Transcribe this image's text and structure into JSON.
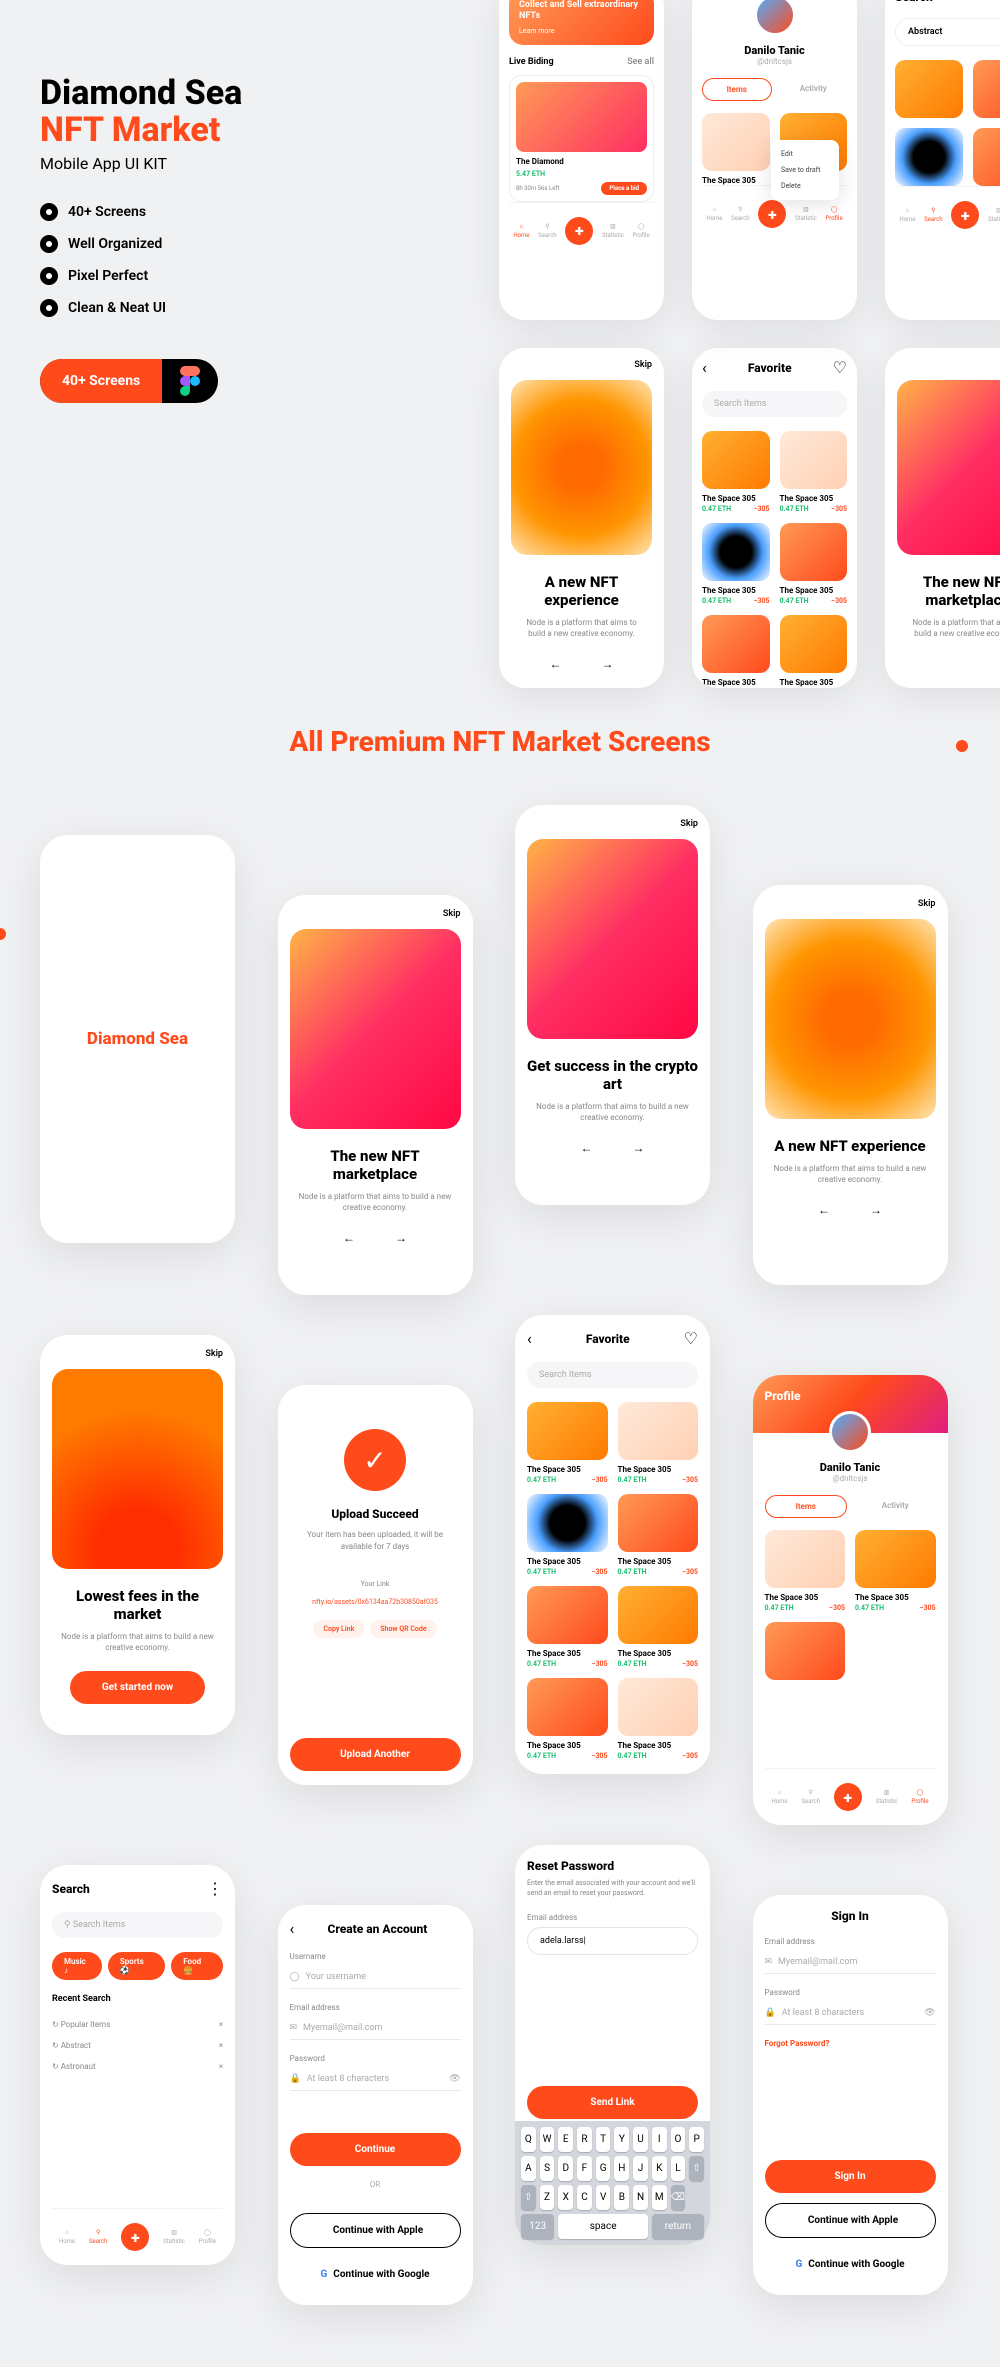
{
  "hero": {
    "title1": "Diamond Sea",
    "title2": "NFT Market",
    "subtitle": "Mobile App UI KIT",
    "features": [
      "40+ Screens",
      "Well Organized",
      "Pixel Perfect",
      "Clean & Neat UI"
    ],
    "cta": "40+ Screens"
  },
  "section_title": "All Premium NFT Market Screens",
  "common": {
    "skip": "Skip",
    "ob_desc": "Node is a platform that aims to build a new creative economy.",
    "nav": {
      "home": "Home",
      "search": "Search",
      "statistic": "Statistic",
      "profile": "Profile"
    },
    "item_name": "The Space 305",
    "price": "0.47 ETH",
    "change": "−305"
  },
  "top": {
    "promo": {
      "title": "Collect and Sell extraordinary NFTs",
      "learn": "Learn more"
    },
    "live": {
      "heading": "Live Biding",
      "see": "See all",
      "item": "The Diamond",
      "price": "5.47 ETH",
      "time": "8h 30m 56s Left",
      "btn": "Place a bid"
    },
    "profile": {
      "name": "Danilo Tanic",
      "handle": "@dnltcsjs",
      "tab_items": "Items",
      "tab_activity": "Activity"
    },
    "menu": {
      "edit": "Edit",
      "save": "Save to draft",
      "delete": "Delete"
    },
    "search": {
      "title": "Search",
      "term": "Abstract"
    },
    "ob1": {
      "title": "A new NFT experience"
    },
    "favorite": {
      "title": "Favorite",
      "search": "Search Items"
    },
    "ob2": {
      "title": "The new NFT marketplace"
    }
  },
  "row1": {
    "splash": "Diamond Sea",
    "ob_marketplace": "The new NFT marketplace",
    "ob_crypto": "Get success in the crypto art",
    "ob_experience": "A new NFT experience"
  },
  "row2": {
    "lowest": {
      "title": "Lowest fees in the market",
      "btn": "Get started now"
    },
    "upload": {
      "title": "Upload Succeed",
      "desc": "Your item has been uploaded, it will be available for 7 days",
      "link_label": "Your Link",
      "link": "nfty.io/assets/0x6134aa72b30850af035",
      "copy": "Copy Link",
      "share": "Show QR Code",
      "another": "Upload Another"
    },
    "favorite": {
      "title": "Favorite",
      "search": "Search Items"
    },
    "profile": {
      "title": "Profile",
      "name": "Danilo Tanic",
      "handle": "@dnltcsjs",
      "tab_items": "Items",
      "tab_activity": "Activity"
    }
  },
  "row3": {
    "search": {
      "title": "Search",
      "ph": "Search Items",
      "chips": [
        "Music",
        "Sports",
        "Food"
      ],
      "recent_title": "Recent Search",
      "recent": [
        "Popular Items",
        "Abstract",
        "Astronaut"
      ]
    },
    "create": {
      "title": "Create an Account",
      "user_lbl": "Username",
      "user_ph": "Your username",
      "email_lbl": "Email address",
      "email_ph": "Myemail@mail.com",
      "pass_lbl": "Password",
      "pass_ph": "At least 8 characters",
      "continue": "Continue",
      "or": "OR",
      "apple": "Continue with Apple",
      "google": "Continue with Google"
    },
    "reset": {
      "title": "Reset Password",
      "desc": "Enter the email associated with your account and we'll send an email to reset your password.",
      "email_lbl": "Email address",
      "email_val": "adela.larss|",
      "send": "Send Link",
      "keys": [
        "Q",
        "W",
        "E",
        "R",
        "T",
        "Y",
        "U",
        "I",
        "O",
        "P",
        "A",
        "S",
        "D",
        "F",
        "G",
        "H",
        "J",
        "K",
        "L",
        "",
        "Z",
        "X",
        "C",
        "V",
        "B",
        "N",
        "M",
        "",
        "",
        "",
        "123",
        "space",
        "return"
      ]
    },
    "signin": {
      "title": "Sign In",
      "email_lbl": "Email address",
      "email_ph": "Myemail@mail.com",
      "pass_lbl": "Password",
      "pass_ph": "At least 8 characters",
      "forgot": "Forgot Password?",
      "signin": "Sign In",
      "apple": "Continue with Apple",
      "google": "Continue with Google"
    }
  }
}
